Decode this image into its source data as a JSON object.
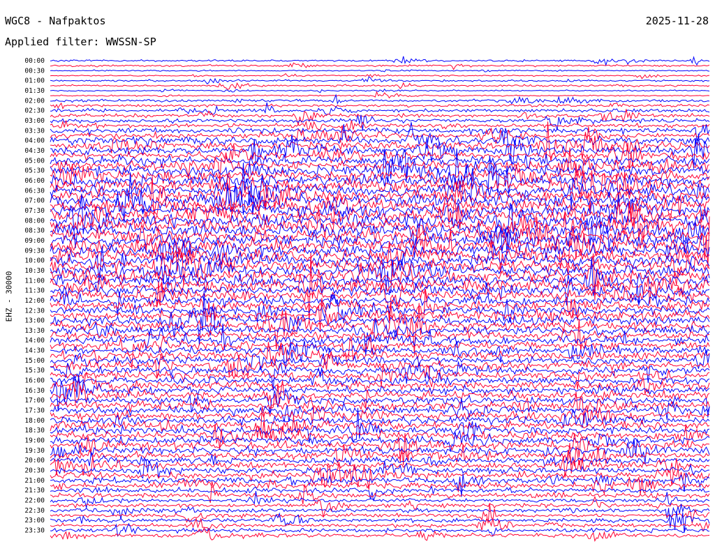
{
  "header": {
    "station": "WGC8 - Nafpaktos",
    "date": "2025-11-28",
    "filter": "Applied filter: WWSSN-SP"
  },
  "axis": {
    "side_label": "EHZ - 30000"
  },
  "chart_data": {
    "type": "line",
    "variant": "helicorder",
    "title": "WGC8 - Nafpaktos",
    "date": "2025-11-28",
    "filter": "WWSSN-SP",
    "ylabel": "EHZ - 30000",
    "trace_interval_minutes": 15,
    "row_labels": [
      "00:00",
      "00:30",
      "01:00",
      "01:30",
      "02:00",
      "02:30",
      "03:00",
      "03:30",
      "04:00",
      "04:30",
      "05:00",
      "05:30",
      "06:00",
      "06:30",
      "07:00",
      "07:30",
      "08:00",
      "08:30",
      "09:00",
      "09:30",
      "10:00",
      "10:30",
      "11:00",
      "11:30",
      "12:00",
      "12:30",
      "13:00",
      "13:30",
      "14:00",
      "14:30",
      "15:00",
      "15:30",
      "16:00",
      "16:30",
      "17:00",
      "17:30",
      "18:00",
      "18:30",
      "19:00",
      "19:30",
      "20:00",
      "20:30",
      "21:00",
      "21:30",
      "22:00",
      "22:30",
      "23:00",
      "23:30"
    ],
    "colors": {
      "even": "#0000ff",
      "odd": "#ff0033"
    },
    "noise_amplitude": [
      1.5,
      1,
      1.5,
      1,
      2,
      2.5,
      3,
      4,
      6,
      6,
      7,
      8,
      9,
      9,
      10,
      10,
      10,
      10,
      10,
      10,
      9,
      9,
      9,
      8,
      7,
      7,
      7,
      6,
      6,
      6,
      6,
      6,
      6,
      6,
      6,
      6,
      6,
      6,
      6,
      6,
      5,
      5,
      5,
      4,
      3,
      3,
      3,
      3
    ]
  }
}
